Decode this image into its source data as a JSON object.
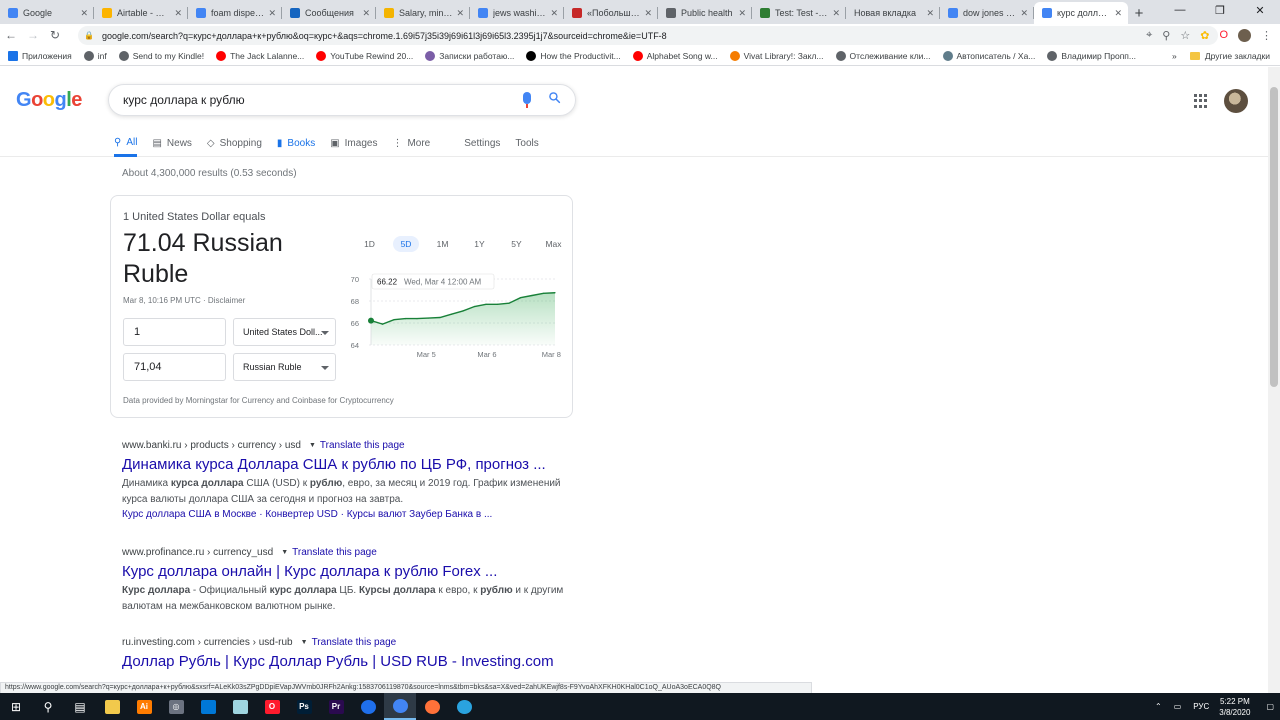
{
  "browser": {
    "tabs": [
      {
        "label": "Google",
        "color": "#4285f4"
      },
      {
        "label": "Airtable - Grid",
        "color": "#fcb400"
      },
      {
        "label": "foam dispenser",
        "color": "#4285f4"
      },
      {
        "label": "Сообщения",
        "color": "#1565c0"
      },
      {
        "label": "Salary, minimum",
        "color": "#f4b400"
      },
      {
        "label": "jews washing",
        "color": "#4285f4"
      },
      {
        "label": "«Побольше»",
        "color": "#c62828"
      },
      {
        "label": "Public health",
        "color": "#5f6368"
      },
      {
        "label": "Test: Test - Air",
        "color": "#2e7d32"
      },
      {
        "label": "Новая вкладка",
        "color": "#ffffff"
      },
      {
        "label": "dow jones cha",
        "color": "#4285f4"
      },
      {
        "label": "курс доллара",
        "color": "#4285f4"
      }
    ],
    "active_tab_index": 11,
    "new_tab": "+",
    "window_controls": {
      "minimize": "—",
      "maximize": "❐",
      "close": "✕"
    },
    "url": "google.com/search?q=курс+доллара+к+рублю&oq=курс+&aqs=chrome.1.69i57j35i39j69i61l3j69i65l3.2395j1j7&sourceid=chrome&ie=UTF-8",
    "bookmarks": [
      {
        "label": "Приложения",
        "color": "#1a73e8"
      },
      {
        "label": "inf",
        "color": "#5f6368"
      },
      {
        "label": "Send to my Kindle!",
        "color": "#5f6368"
      },
      {
        "label": "The Jack Lalanne...",
        "color": "#ff0000"
      },
      {
        "label": "YouTube Rewind 20...",
        "color": "#ff0000"
      },
      {
        "label": "Записки работаю...",
        "color": "#7b5ea7"
      },
      {
        "label": "How the Productivit...",
        "color": "#000000"
      },
      {
        "label": "Alphabet Song w...",
        "color": "#ff0000"
      },
      {
        "label": "Vivat Library!: Закл...",
        "color": "#f57c00"
      },
      {
        "label": "Отслеживание кли...",
        "color": "#5f6368"
      },
      {
        "label": "Автописатель / Ха...",
        "color": "#607d8b"
      },
      {
        "label": "Владимир Пропп...",
        "color": "#5f6368"
      }
    ],
    "other_bookmarks": "Другие закладки",
    "bookmarks_more": "»"
  },
  "google": {
    "query": "курс доллара к рублю",
    "logo": "Google",
    "tabs": [
      {
        "label": "All",
        "icon": "search-icon",
        "active": true
      },
      {
        "label": "News",
        "icon": "news-icon"
      },
      {
        "label": "Shopping",
        "icon": "tag-icon"
      },
      {
        "label": "Books",
        "icon": "book-icon",
        "highlight": true
      },
      {
        "label": "Images",
        "icon": "image-icon"
      },
      {
        "label": "More",
        "icon": "more-icon"
      },
      {
        "label": "Settings"
      },
      {
        "label": "Tools"
      }
    ],
    "results_count": "About 4,300,000 results (0.53 seconds)"
  },
  "currency_card": {
    "equals": "1 United States Dollar equals",
    "value": "71.04 Russian Ruble",
    "date": "Mar 8, 10:16 PM UTC · Disclaimer",
    "from_amount": "1",
    "from_currency": "United States Doll...",
    "to_amount": "71,04",
    "to_currency": "Russian Ruble",
    "provided_by": "Data provided by Morningstar for Currency and Coinbase for Cryptocurrency",
    "ranges": [
      "1D",
      "5D",
      "1M",
      "1Y",
      "5Y",
      "Max"
    ],
    "active_range": "5D",
    "tooltip_value": "66.22",
    "tooltip_date": "Wed, Mar 4 12:00 AM"
  },
  "chart_data": {
    "type": "line",
    "title": "",
    "x_ticks": [
      "Mar 5",
      "Mar 6",
      "Mar 8"
    ],
    "y_ticks": [
      70,
      68,
      66,
      64
    ],
    "ylim": [
      64,
      70
    ],
    "series": [
      {
        "x": [
          "Mar 4 00:00",
          "Mar 4 06:00",
          "Mar 4 12:00",
          "Mar 4 18:00",
          "Mar 5 00:00",
          "Mar 5 06:00",
          "Mar 5 12:00",
          "Mar 5 18:00",
          "Mar 6 00:00",
          "Mar 6 06:00",
          "Mar 6 12:00",
          "Mar 6 18:00",
          "Mar 7 00:00",
          "Mar 7 12:00",
          "Mar 8 00:00",
          "Mar 8 12:00",
          "Mar 8 22:00"
        ],
        "values": [
          66.22,
          65.9,
          66.3,
          66.4,
          66.4,
          66.45,
          66.5,
          66.8,
          67.1,
          67.5,
          67.7,
          67.7,
          67.8,
          68.3,
          68.5,
          68.7,
          68.75
        ]
      }
    ],
    "color": "#188038"
  },
  "results": [
    {
      "crumb": "www.banki.ru › products › currency › usd",
      "translate": "Translate this page",
      "title": "Динамика курса Доллара США к рублю по ЦБ РФ, прогноз ...",
      "snippet_html": "Динамика <b>курса доллара</b> США (USD) к <b>рублю</b>, евро, за месяц и 2019 год. График изменений курса валюты доллара США за сегодня и прогноз на завтра.",
      "sitelinks": "Курс доллара США в Москве · Конвертер USD · Курсы валют Заубер Банка в ..."
    },
    {
      "crumb": "www.profinance.ru › currency_usd",
      "translate": "Translate this page",
      "title": "Курс доллара онлайн | Курс доллара к рублю Forex ...",
      "snippet_html": "<b>Курс доллара</b> - Официальный <b>курс доллара</b> ЦБ. <b>Курсы доллара</b> к евро, к <b>рублю</b> и к другим валютам на межбанковском валютном рынке."
    },
    {
      "crumb": "ru.investing.com › currencies › usd-rub",
      "translate": "Translate this page",
      "title": "Доллар Рубль | Курс Доллар Рубль | USD RUB - Investing.com"
    }
  ],
  "status_url": "https://www.google.com/search?q=курс+доллара+к+рублю&sxsrf=ALeKk03sZPgDDpiEVapJWVmb0JRFh2Ankg:1583706119870&source=lnms&tbm=bks&sa=X&ved=2ahUKEwjf8s-F9YvoAhXFKH0KHal0C1oQ_AUoA3oECA0Q8Q",
  "taskbar": {
    "apps": [
      {
        "name": "start",
        "color": "#101820",
        "glyph": "⊞"
      },
      {
        "name": "search",
        "color": "#101820",
        "glyph": "⚲"
      },
      {
        "name": "task-view",
        "color": "#101820",
        "glyph": "▤"
      },
      {
        "name": "file-explorer",
        "color": "#f2c94c",
        "glyph": ""
      },
      {
        "name": "illustrator",
        "color": "#ff7c00",
        "glyph": "Ai"
      },
      {
        "name": "app-settings",
        "color": "#6b7280",
        "glyph": "◎"
      },
      {
        "name": "app-blue",
        "color": "#0078d7",
        "glyph": ""
      },
      {
        "name": "app-notes",
        "color": "#9fd5e0",
        "glyph": ""
      },
      {
        "name": "opera",
        "color": "#ff1b2d",
        "glyph": "O"
      },
      {
        "name": "photoshop",
        "color": "#001e36",
        "glyph": "Ps"
      },
      {
        "name": "premiere",
        "color": "#2a0a4f",
        "glyph": "Pr"
      },
      {
        "name": "app-bird",
        "color": "#1f6feb",
        "glyph": ""
      },
      {
        "name": "chrome",
        "color": "#4285f4",
        "glyph": ""
      },
      {
        "name": "firefox",
        "color": "#ff7139",
        "glyph": ""
      },
      {
        "name": "telegram",
        "color": "#2aa3df",
        "glyph": ""
      }
    ],
    "active_app": "chrome",
    "language": "РУС",
    "time": "5:22 PM",
    "date": "3/8/2020"
  }
}
